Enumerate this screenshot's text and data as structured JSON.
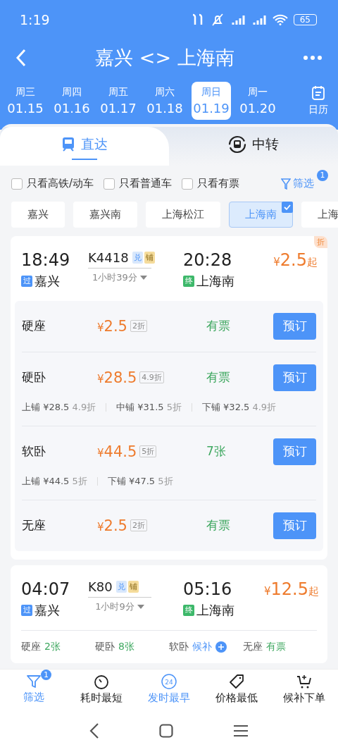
{
  "status_bar": {
    "time": "1:19",
    "battery": "65"
  },
  "header": {
    "title": "嘉兴 <> 上海南"
  },
  "dates": [
    {
      "weekday": "周三",
      "date": "01.15",
      "selected": false
    },
    {
      "weekday": "周四",
      "date": "01.16",
      "selected": false
    },
    {
      "weekday": "周五",
      "date": "01.17",
      "selected": false
    },
    {
      "weekday": "周六",
      "date": "01.18",
      "selected": false
    },
    {
      "weekday": "周日",
      "date": "01.19",
      "selected": true
    },
    {
      "weekday": "周一",
      "date": "01.20",
      "selected": false
    }
  ],
  "calendar": {
    "label": "日历"
  },
  "tabs": [
    {
      "label": "直达",
      "selected": true,
      "kind": "direct"
    },
    {
      "label": "中转",
      "selected": false,
      "kind": "transfer"
    }
  ],
  "checkboxes": [
    {
      "label": "只看高铁/动车",
      "checked": false
    },
    {
      "label": "只看普通车",
      "checked": false
    },
    {
      "label": "只看有票",
      "checked": false
    }
  ],
  "filter_button": {
    "label": "筛选",
    "badge": "1"
  },
  "stations": [
    {
      "label": "嘉兴",
      "selected": false
    },
    {
      "label": "嘉兴南",
      "selected": false
    },
    {
      "label": "上海松江",
      "selected": false
    },
    {
      "label": "上海南",
      "selected": true
    },
    {
      "label": "上海",
      "selected": false
    }
  ],
  "trains": [
    {
      "kind": "expanded",
      "corner_tag": "折",
      "depart_time": "18:49",
      "depart_tag": "过",
      "depart_station": "嘉兴",
      "train_no": "K4418",
      "badges": [
        {
          "label": "兑",
          "kind": "exchange"
        },
        {
          "label": "铺",
          "kind": "berth"
        }
      ],
      "duration": "1小时39分",
      "arrive_time": "20:28",
      "arrive_tag": "终",
      "arrive_station": "上海南",
      "currency": "¥",
      "price": "2.5",
      "price_suffix": "起",
      "seats": [
        {
          "name": "硬座",
          "currency": "¥",
          "price": "2.5",
          "discount": "2折",
          "availability": "有票",
          "action": "预订"
        },
        {
          "name": "硬卧",
          "currency": "¥",
          "price": "28.5",
          "discount": "4.9折",
          "availability": "有票",
          "action": "预订",
          "berths": [
            {
              "name": "上铺 ¥28.5",
              "discount": "4.9折"
            },
            {
              "name": "中铺 ¥31.5",
              "discount": "5折"
            },
            {
              "name": "下铺 ¥32.5",
              "discount": "4.9折"
            }
          ]
        },
        {
          "name": "软卧",
          "currency": "¥",
          "price": "44.5",
          "discount": "5折",
          "availability": "7张",
          "action": "预订",
          "berths": [
            {
              "name": "上铺 ¥44.5",
              "discount": "5折"
            },
            {
              "name": "下铺 ¥47.5",
              "discount": "5折"
            }
          ]
        },
        {
          "name": "无座",
          "currency": "¥",
          "price": "2.5",
          "discount": "2折",
          "availability": "有票",
          "action": "预订"
        }
      ]
    },
    {
      "kind": "compact",
      "depart_time": "04:07",
      "depart_tag": "过",
      "depart_station": "嘉兴",
      "train_no": "K80",
      "badges": [
        {
          "label": "兑",
          "kind": "exchange"
        },
        {
          "label": "铺",
          "kind": "berth"
        }
      ],
      "duration": "1小时9分",
      "arrive_time": "05:16",
      "arrive_tag": "终",
      "arrive_station": "上海南",
      "currency": "¥",
      "price": "12.5",
      "price_suffix": "起",
      "summary": [
        {
          "name": "硬座",
          "availability": "2张",
          "kind": "count"
        },
        {
          "name": "硬卧",
          "availability": "8张",
          "kind": "count"
        },
        {
          "name": "软卧",
          "availability": "候补",
          "kind": "waitlist"
        },
        {
          "name": "无座",
          "availability": "有票",
          "kind": "count"
        }
      ]
    }
  ],
  "bottom_nav": [
    {
      "label": "筛选",
      "active": true,
      "badge": "1"
    },
    {
      "label": "耗时最短",
      "active": false
    },
    {
      "label": "发时最早",
      "active": true,
      "icon_text": "24"
    },
    {
      "label": "价格最低",
      "active": false
    },
    {
      "label": "候补下单",
      "active": false
    }
  ]
}
